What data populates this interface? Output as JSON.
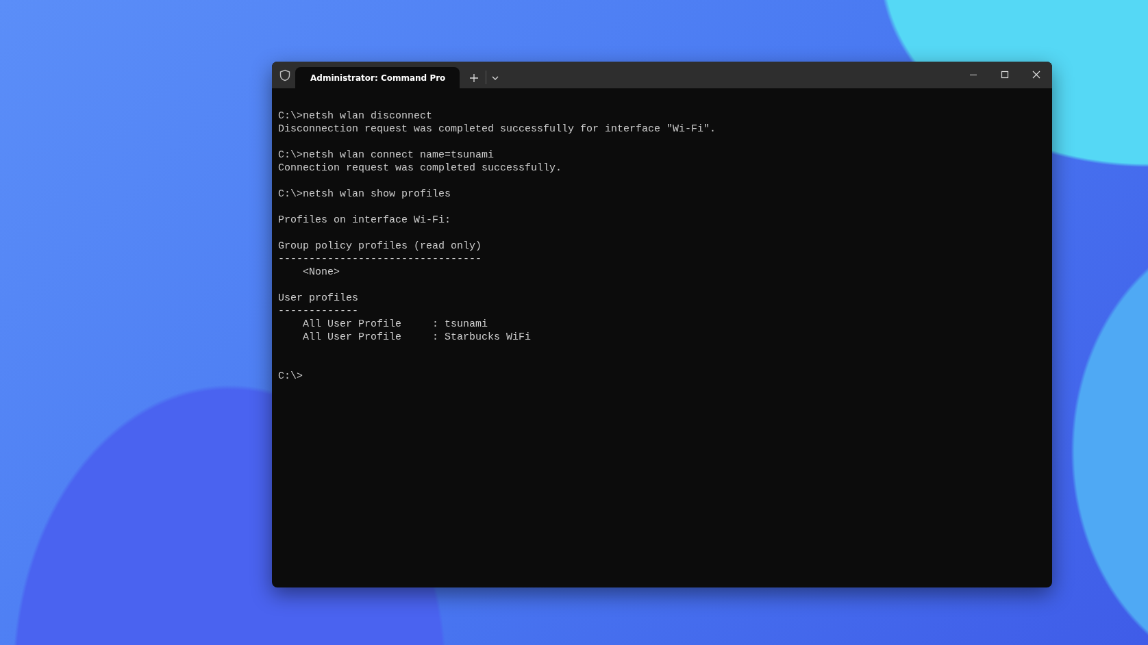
{
  "window": {
    "tabs": [
      {
        "title": "Administrator: Command Pro",
        "selected": true
      }
    ]
  },
  "terminal": {
    "lines": [
      {
        "kind": "text",
        "text": "C:\\>netsh wlan disconnect"
      },
      {
        "kind": "text",
        "text": "Disconnection request was completed successfully for interface \"Wi-Fi\"."
      },
      {
        "kind": "blank"
      },
      {
        "kind": "text",
        "text": "C:\\>netsh wlan connect name=tsunami"
      },
      {
        "kind": "text",
        "text": "Connection request was completed successfully."
      },
      {
        "kind": "blank"
      },
      {
        "kind": "text",
        "text": "C:\\>netsh wlan show profiles"
      },
      {
        "kind": "blank"
      },
      {
        "kind": "text",
        "text": "Profiles on interface Wi-Fi:"
      },
      {
        "kind": "blank"
      },
      {
        "kind": "text",
        "text": "Group policy profiles (read only)"
      },
      {
        "kind": "text",
        "text": "---------------------------------"
      },
      {
        "kind": "text",
        "text": "    <None>"
      },
      {
        "kind": "blank"
      },
      {
        "kind": "text",
        "text": "User profiles"
      },
      {
        "kind": "text",
        "text": "-------------"
      },
      {
        "kind": "text",
        "text": "    All User Profile     : tsunami"
      },
      {
        "kind": "text",
        "text": "    All User Profile     : Starbucks WiFi"
      },
      {
        "kind": "blank"
      },
      {
        "kind": "blank"
      },
      {
        "kind": "text",
        "text": "C:\\>"
      }
    ]
  }
}
